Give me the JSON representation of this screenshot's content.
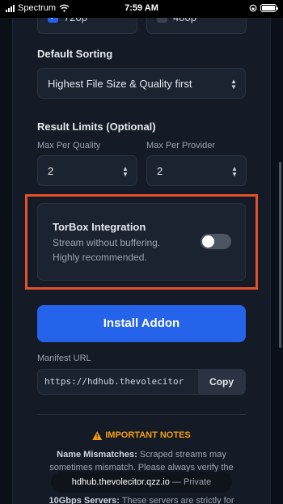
{
  "status_bar": {
    "carrier": "Spectrum",
    "time": "7:59 AM"
  },
  "quality": {
    "options": [
      {
        "label": "720p",
        "checked": true
      },
      {
        "label": "480p",
        "checked": false
      }
    ]
  },
  "sorting": {
    "label": "Default Sorting",
    "value": "Highest File Size & Quality first"
  },
  "limits": {
    "label": "Result Limits (Optional)",
    "per_quality_label": "Max Per Quality",
    "per_quality_value": "2",
    "per_provider_label": "Max Per Provider",
    "per_provider_value": "2"
  },
  "torbox": {
    "title": "TorBox Integration",
    "desc_line1": "Stream without buffering.",
    "desc_line2": "Highly recommended.",
    "enabled": false
  },
  "install": {
    "label": "Install Addon"
  },
  "manifest": {
    "label": "Manifest URL",
    "url": "https://hdhub.thevolecitor",
    "copy_label": "Copy"
  },
  "notes": {
    "title": "IMPORTANT NOTES",
    "items": [
      {
        "heading": "Name Mismatches:",
        "line1": " Scraped streams may",
        "line2": "sometimes mismatch. Please always verify the"
      },
      {
        "heading": "10Gbps Servers:",
        "line1": " These servers are strictly for"
      }
    ]
  },
  "browser": {
    "domain": "hdhub.thevolecitor.qzz.io",
    "mode": "— Private"
  },
  "colors": {
    "accent": "#2563eb",
    "highlight": "#e4502a",
    "warning": "#f59e0b",
    "background": "#151b26"
  }
}
